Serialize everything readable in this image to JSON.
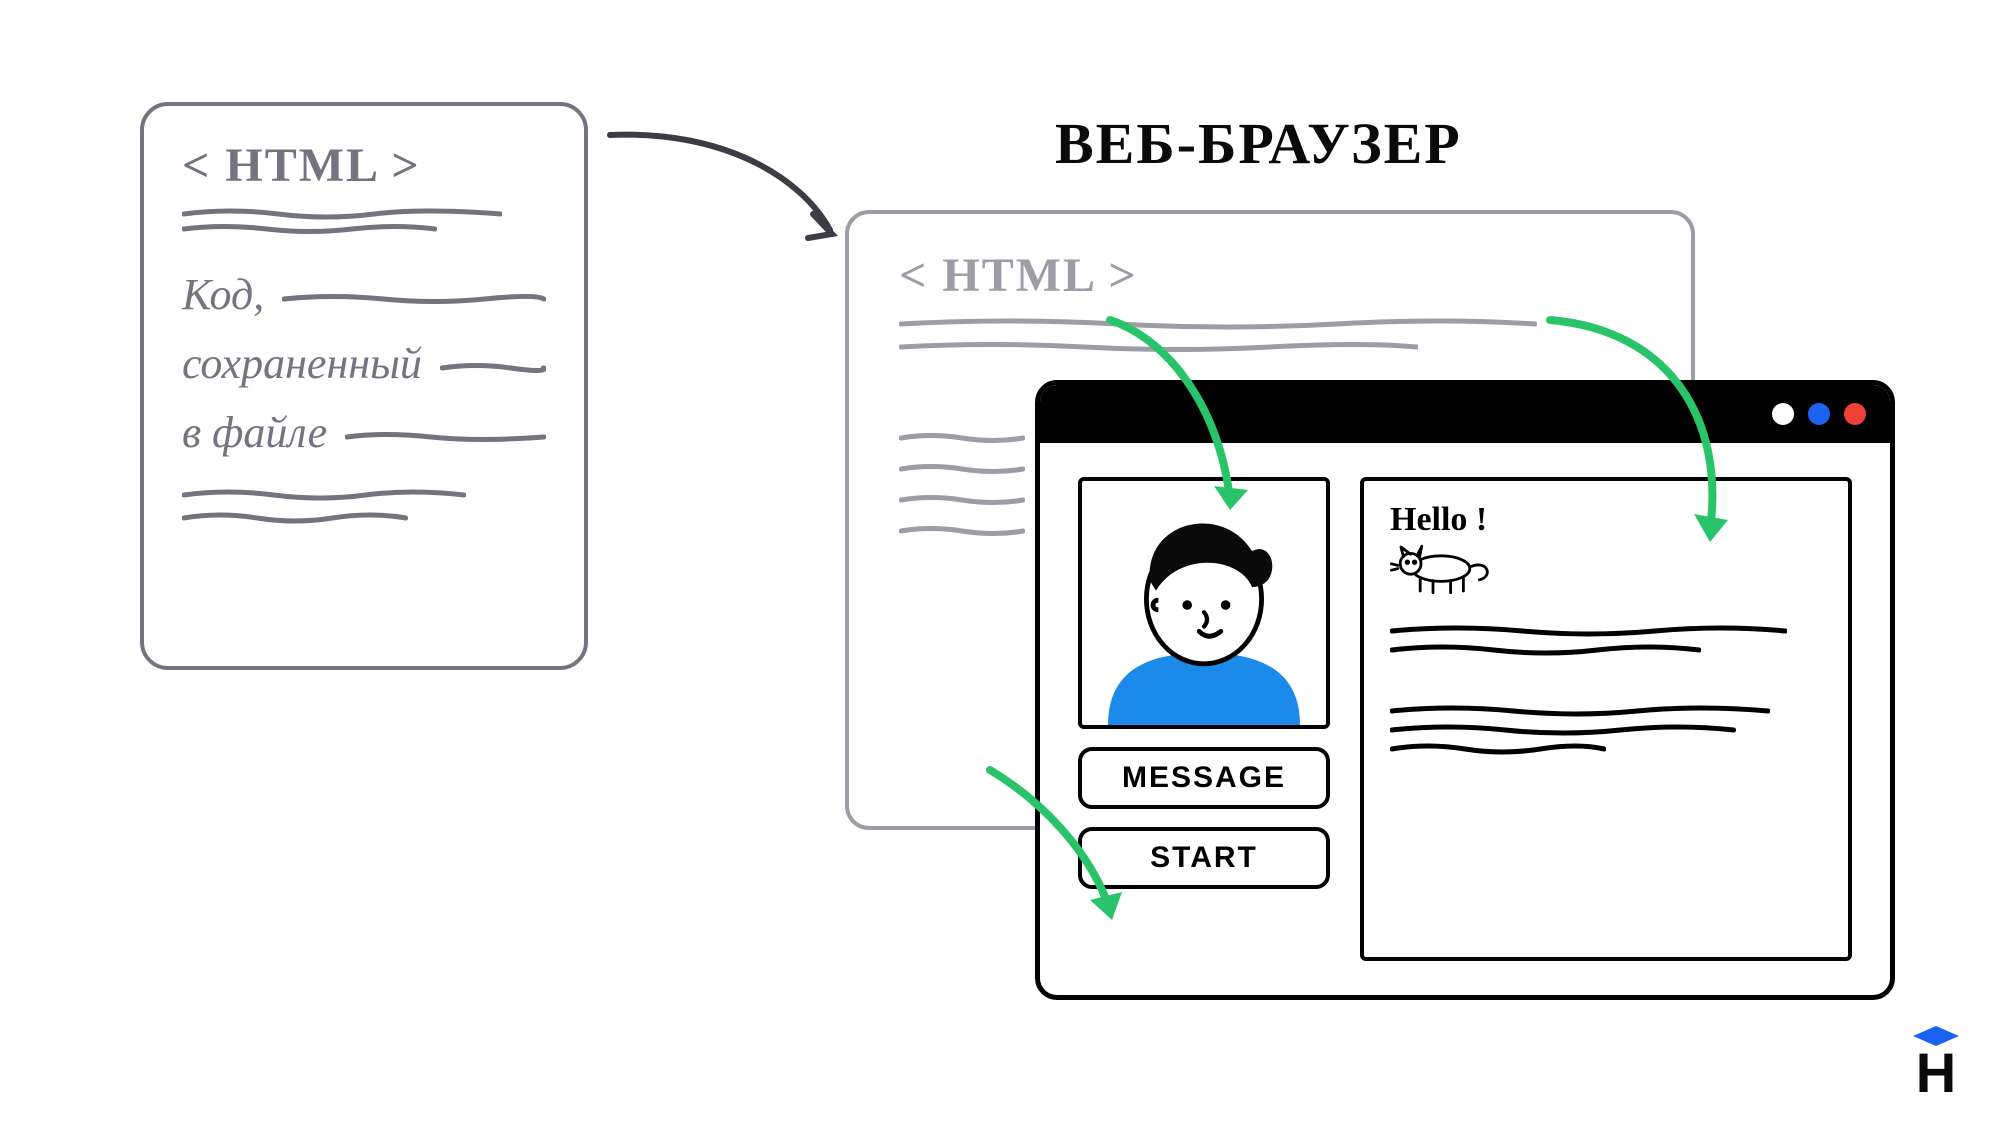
{
  "diagram": {
    "source_card": {
      "tag_label": "< HTML >",
      "note_line1": "Код,",
      "note_line2": "сохраненный",
      "note_line3": "в файле"
    },
    "browser_heading": "ВЕБ-БРАУЗЕР",
    "browser_window": {
      "tag_label": "< HTML >"
    },
    "app_window": {
      "buttons": {
        "message_label": "MESSAGE",
        "start_label": "START"
      },
      "content": {
        "greeting": "Hello !"
      }
    },
    "watermark": {
      "letter": "H"
    }
  }
}
